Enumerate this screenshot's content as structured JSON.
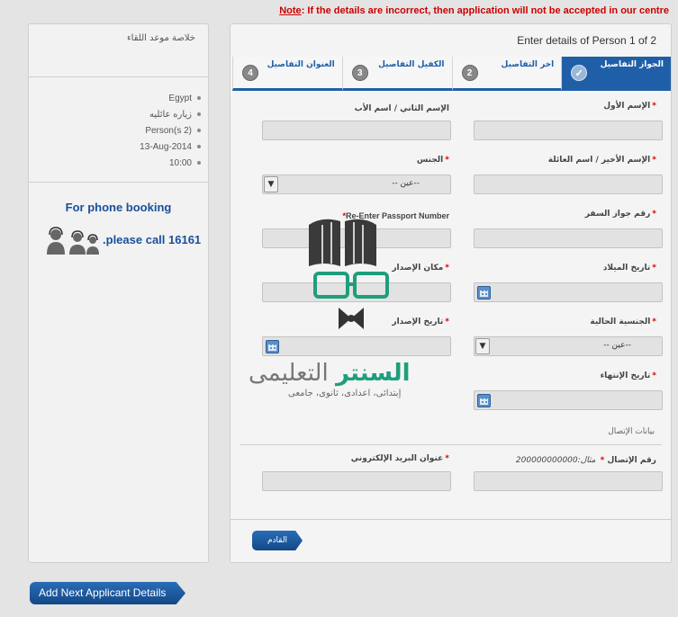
{
  "notice": {
    "label": "Note",
    "text": ": If the details are incorrect, then application will not be accepted in our centre"
  },
  "summary": {
    "title": "خلاصة موعد اللقاء",
    "items": [
      "Egypt",
      "زياره عائليه",
      "Person(s 2)",
      "13-Aug-2014",
      "10:00"
    ],
    "phone_heading": "For phone booking",
    "call_prefix": "please call ",
    "call_number": "16161",
    "call_suffix": "."
  },
  "form": {
    "heading": "Enter details of Person 1 of 2",
    "steps": [
      {
        "num": "✓",
        "label": "الجواز التفاصيل",
        "active": true
      },
      {
        "num": "2",
        "label": "اخر التفاصيل",
        "active": false
      },
      {
        "num": "3",
        "label": "الكفيل التفاصيل",
        "active": false
      },
      {
        "num": "4",
        "label": "العنوان التفاصيل",
        "active": false
      }
    ],
    "fields": {
      "first_name": "الإسم الأول",
      "middle_name": "الإسم الثاني / اسم الأب",
      "last_name": "الإسم الأخير / اسم العائلة",
      "gender": "الجنس",
      "gender_value": "--عين --",
      "passport_number": "رقم جواز السفر",
      "reenter_passport": "Re-Enter Passport Number",
      "birth_date": "تاريخ الميلاد",
      "issue_place": "مكان الإصدار",
      "nationality": "الجنسية الحالية",
      "nationality_value": "--عين --",
      "issue_date": "تاريخ الإصدار",
      "expiry_date": "تاريخ الإنتهاء",
      "contact_title": "بيانات الإتصال",
      "phone": "رقم الإتصال",
      "phone_example_label": "مثال:",
      "phone_example": "200000000000",
      "email": "عنوان البريد الإلكتروني"
    },
    "next_button": "القادم"
  },
  "add_next_button": "Add Next Applicant Details",
  "watermark": {
    "brand_a": "السنتر",
    "brand_b": " التعليمى",
    "tagline": "إبتدائى، اعدادى، ثانوى، جامعى"
  }
}
